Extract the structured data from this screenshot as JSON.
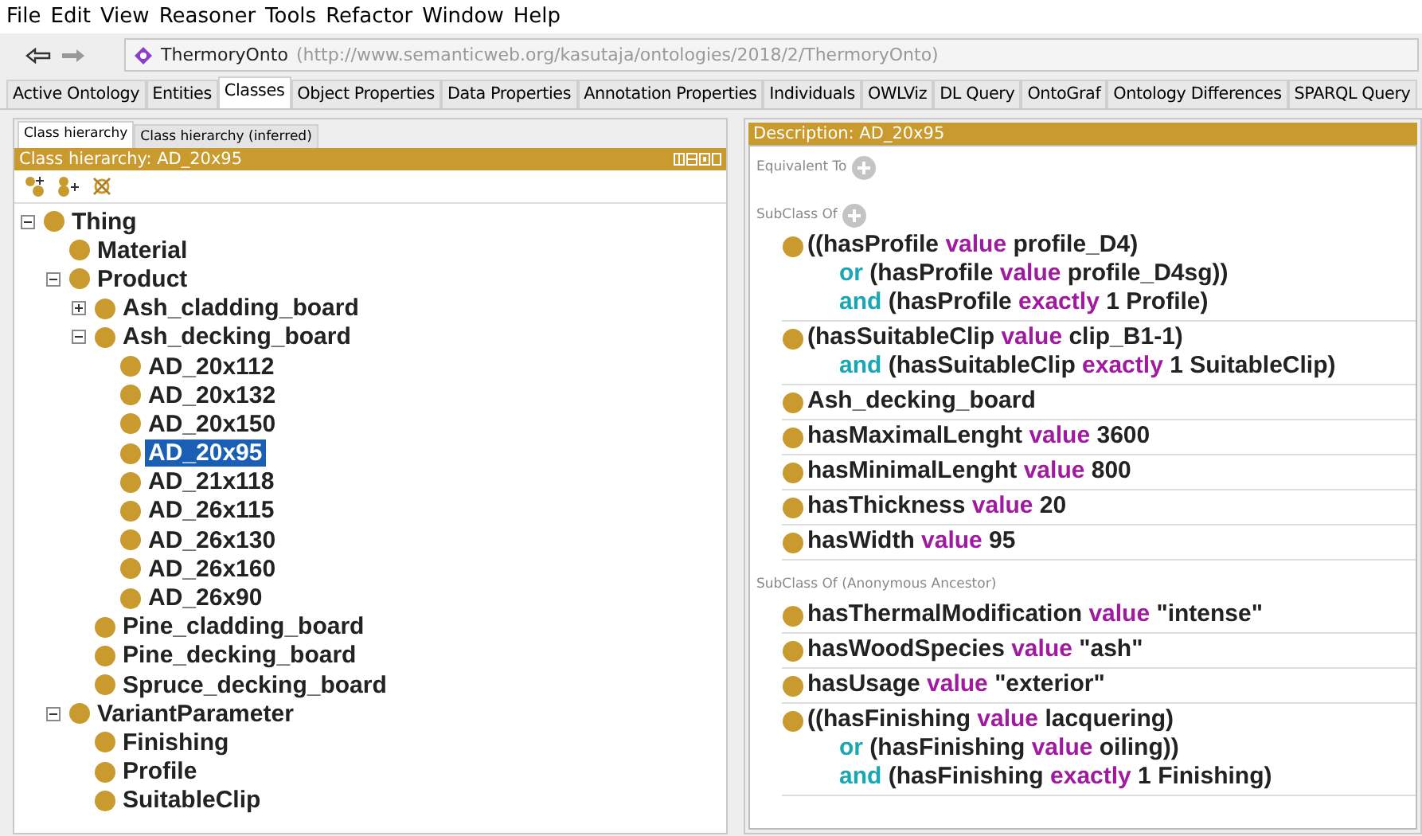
{
  "menu": [
    "File",
    "Edit",
    "View",
    "Reasoner",
    "Tools",
    "Refactor",
    "Window",
    "Help"
  ],
  "address": {
    "name": "ThermoryOnto",
    "iri": "(http://www.semanticweb.org/kasutaja/ontologies/2018/2/ThermoryOnto)"
  },
  "tabs": [
    {
      "label": "Active Ontology",
      "selected": false
    },
    {
      "label": "Entities",
      "selected": false
    },
    {
      "label": "Classes",
      "selected": true
    },
    {
      "label": "Object Properties",
      "selected": false
    },
    {
      "label": "Data Properties",
      "selected": false
    },
    {
      "label": "Annotation Properties",
      "selected": false
    },
    {
      "label": "Individuals",
      "selected": false
    },
    {
      "label": "OWLViz",
      "selected": false
    },
    {
      "label": "DL Query",
      "selected": false
    },
    {
      "label": "OntoGraf",
      "selected": false
    },
    {
      "label": "Ontology Differences",
      "selected": false
    },
    {
      "label": "SPARQL Query",
      "selected": false
    }
  ],
  "left_panel": {
    "subtabs": [
      {
        "label": "Class hierarchy",
        "selected": true
      },
      {
        "label": "Class hierarchy (inferred)",
        "selected": false
      }
    ],
    "header": "Class hierarchy: AD_20x95",
    "tree": [
      {
        "label": "Thing",
        "selected": false,
        "expanded": true,
        "children": [
          {
            "label": "Material",
            "selected": false
          },
          {
            "label": "Product",
            "selected": false,
            "expanded": true,
            "children": [
              {
                "label": "Ash_cladding_board",
                "selected": false,
                "expanded": false
              },
              {
                "label": "Ash_decking_board",
                "selected": false,
                "expanded": true,
                "children": [
                  {
                    "label": "AD_20x112",
                    "selected": false
                  },
                  {
                    "label": "AD_20x132",
                    "selected": false
                  },
                  {
                    "label": "AD_20x150",
                    "selected": false
                  },
                  {
                    "label": "AD_20x95",
                    "selected": true
                  },
                  {
                    "label": "AD_21x118",
                    "selected": false
                  },
                  {
                    "label": "AD_26x115",
                    "selected": false
                  },
                  {
                    "label": "AD_26x130",
                    "selected": false
                  },
                  {
                    "label": "AD_26x160",
                    "selected": false
                  },
                  {
                    "label": "AD_26x90",
                    "selected": false
                  }
                ]
              },
              {
                "label": "Pine_cladding_board",
                "selected": false
              },
              {
                "label": "Pine_decking_board",
                "selected": false
              },
              {
                "label": "Spruce_decking_board",
                "selected": false
              }
            ]
          },
          {
            "label": "VariantParameter",
            "selected": false,
            "expanded": true,
            "children": [
              {
                "label": "Finishing",
                "selected": false
              },
              {
                "label": "Profile",
                "selected": false
              },
              {
                "label": "SuitableClip",
                "selected": false
              }
            ]
          }
        ]
      }
    ]
  },
  "right_panel": {
    "header": "Description: AD_20x95",
    "sections": [
      {
        "title": "Equivalent To",
        "addable": true
      },
      {
        "title": "SubClass Of",
        "addable": true,
        "items": [
          {
            "lines": [
              [
                {
                  "text": "((hasProfile ",
                  "kind": "name"
                },
                {
                  "text": "value",
                  "kind": "keyword"
                },
                {
                  "text": " profile_D4)",
                  "kind": "name"
                }
              ],
              [
                {
                  "text": "or",
                  "kind": "connective"
                },
                {
                  "text": " (hasProfile ",
                  "kind": "name"
                },
                {
                  "text": "value",
                  "kind": "keyword"
                },
                {
                  "text": " profile_D4sg))",
                  "kind": "name"
                }
              ],
              [
                {
                  "text": "and",
                  "kind": "connective"
                },
                {
                  "text": " (hasProfile ",
                  "kind": "name"
                },
                {
                  "text": "exactly",
                  "kind": "keyword"
                },
                {
                  "text": " 1 Profile)",
                  "kind": "name"
                }
              ]
            ]
          },
          {
            "lines": [
              [
                {
                  "text": "(hasSuitableClip ",
                  "kind": "name"
                },
                {
                  "text": "value",
                  "kind": "keyword"
                },
                {
                  "text": " clip_B1-1)",
                  "kind": "name"
                }
              ],
              [
                {
                  "text": "and",
                  "kind": "connective"
                },
                {
                  "text": " (hasSuitableClip ",
                  "kind": "name"
                },
                {
                  "text": "exactly",
                  "kind": "keyword"
                },
                {
                  "text": " 1 SuitableClip)",
                  "kind": "name"
                }
              ]
            ]
          },
          {
            "lines": [
              [
                {
                  "text": "Ash_decking_board",
                  "kind": "name"
                }
              ]
            ]
          },
          {
            "lines": [
              [
                {
                  "text": "hasMaximalLenght ",
                  "kind": "name"
                },
                {
                  "text": "value",
                  "kind": "keyword"
                },
                {
                  "text": " 3600",
                  "kind": "name"
                }
              ]
            ]
          },
          {
            "lines": [
              [
                {
                  "text": "hasMinimalLenght ",
                  "kind": "name"
                },
                {
                  "text": "value",
                  "kind": "keyword"
                },
                {
                  "text": " 800",
                  "kind": "name"
                }
              ]
            ]
          },
          {
            "lines": [
              [
                {
                  "text": "hasThickness ",
                  "kind": "name"
                },
                {
                  "text": "value",
                  "kind": "keyword"
                },
                {
                  "text": " 20",
                  "kind": "name"
                }
              ]
            ]
          },
          {
            "lines": [
              [
                {
                  "text": "hasWidth ",
                  "kind": "name"
                },
                {
                  "text": "value",
                  "kind": "keyword"
                },
                {
                  "text": " 95",
                  "kind": "name"
                }
              ]
            ]
          }
        ]
      },
      {
        "title": "SubClass Of (Anonymous Ancestor)",
        "addable": false,
        "items": [
          {
            "lines": [
              [
                {
                  "text": "hasThermalModification ",
                  "kind": "name"
                },
                {
                  "text": "value",
                  "kind": "keyword"
                },
                {
                  "text": " \"intense\"",
                  "kind": "name"
                }
              ]
            ]
          },
          {
            "lines": [
              [
                {
                  "text": "hasWoodSpecies ",
                  "kind": "name"
                },
                {
                  "text": "value",
                  "kind": "keyword"
                },
                {
                  "text": " \"ash\"",
                  "kind": "name"
                }
              ]
            ]
          },
          {
            "lines": [
              [
                {
                  "text": "hasUsage ",
                  "kind": "name"
                },
                {
                  "text": "value",
                  "kind": "keyword"
                },
                {
                  "text": " \"exterior\"",
                  "kind": "name"
                }
              ]
            ]
          },
          {
            "lines": [
              [
                {
                  "text": "((hasFinishing ",
                  "kind": "name"
                },
                {
                  "text": "value",
                  "kind": "keyword"
                },
                {
                  "text": " lacquering)",
                  "kind": "name"
                }
              ],
              [
                {
                  "text": "or",
                  "kind": "connective"
                },
                {
                  "text": " (hasFinishing ",
                  "kind": "name"
                },
                {
                  "text": "value",
                  "kind": "keyword"
                },
                {
                  "text": " oiling))",
                  "kind": "name"
                }
              ],
              [
                {
                  "text": "and",
                  "kind": "connective"
                },
                {
                  "text": " (hasFinishing ",
                  "kind": "name"
                },
                {
                  "text": "exactly",
                  "kind": "keyword"
                },
                {
                  "text": " 1 Finishing)",
                  "kind": "name"
                }
              ]
            ]
          }
        ]
      }
    ]
  }
}
